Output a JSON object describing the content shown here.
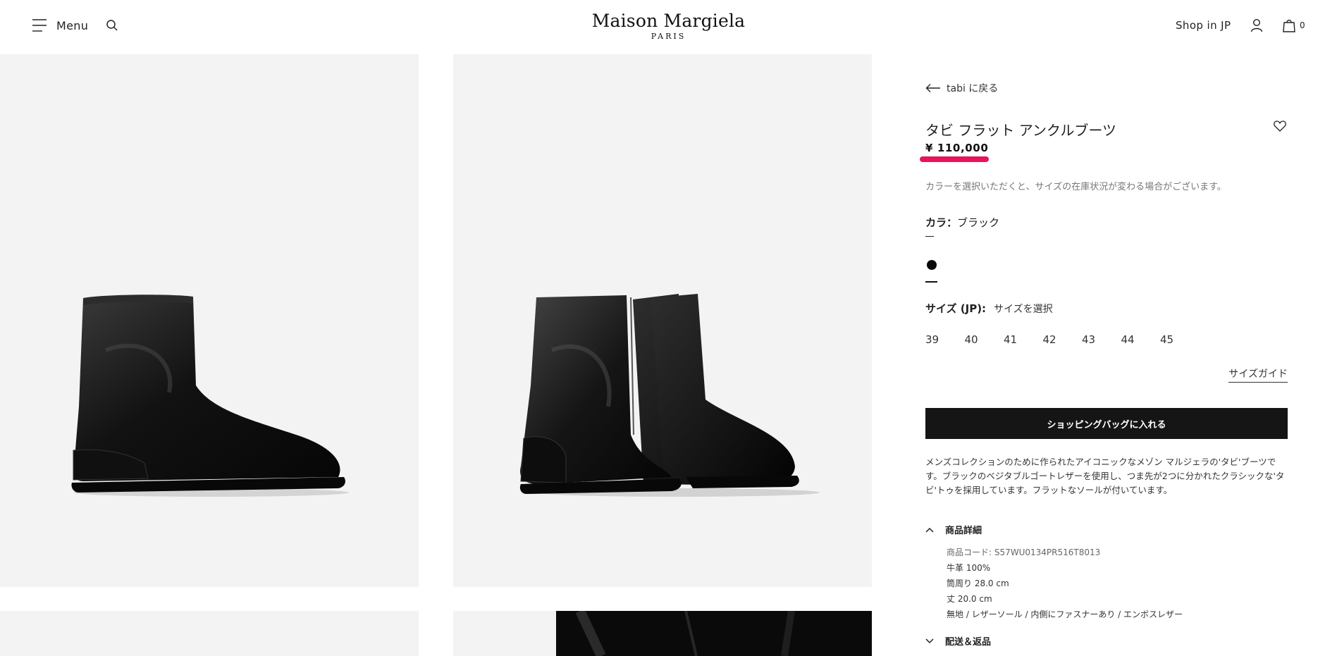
{
  "header": {
    "menu_label": "Menu",
    "logo_main": "Maison Margiela",
    "logo_sub": "PARIS",
    "shop_label": "Shop in JP",
    "bag_count": "0"
  },
  "product": {
    "back_label": "tabi に戻る",
    "title": "タビ フラット アンクルブーツ",
    "price": "¥ 110,000",
    "color_note": "カラーを選択いただくと、サイズの在庫状況が変わる場合がございます。",
    "color_label": "カラ：",
    "color_value": "ブラック",
    "size_label": "サイズ (JP):",
    "size_hint": "サイズを選択",
    "sizes": [
      "39",
      "40",
      "41",
      "42",
      "43",
      "44",
      "45"
    ],
    "size_guide": "サイズガイド",
    "add_to_bag": "ショッピングバッグに入れる",
    "description": "メンズコレクションのために作られたアイコニックなメゾン マルジェラの'タビ'ブーツです。ブラックのベジタブルゴートレザーを使用し、つま先が2つに分かれたクラシックな'タビ'トゥを採用しています。フラットなソールが付いています。",
    "details_title": "商品詳細",
    "details": [
      "商品コード: S57WU0134PR516T8013",
      "牛革 100%",
      "筒周り 28.0 cm",
      "丈 20.0 cm",
      "無地 / レザーソール / 内側にファスナーあり / エンボスレザー"
    ],
    "shipping_title": "配送＆返品"
  },
  "colors": {
    "accent_underline": "#e8145c",
    "button_bg": "#151515",
    "image_bg": "#f3f3f3"
  },
  "icons": [
    "hamburger-icon",
    "search-icon",
    "user-icon",
    "bag-icon",
    "arrow-left-icon",
    "heart-icon",
    "chevron-up-icon",
    "chevron-down-icon"
  ]
}
